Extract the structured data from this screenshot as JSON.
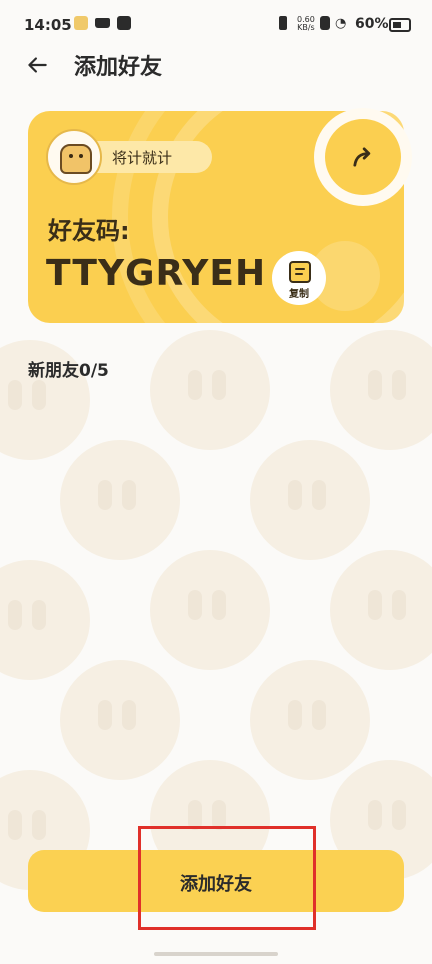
{
  "status": {
    "time": "14:05",
    "network_speed": "0.60",
    "network_unit": "KB/s",
    "battery": "60%"
  },
  "header": {
    "title": "添加好友"
  },
  "card": {
    "badge_text": "将计就计",
    "code_label": "好友码:",
    "code": "TTYGRYEH",
    "copy_label": "复制"
  },
  "friends": {
    "label": "新朋友",
    "count": "0/5"
  },
  "actions": {
    "add_friend": "添加好友"
  },
  "colors": {
    "accent": "#fbcf50",
    "highlight": "#e0302a"
  }
}
